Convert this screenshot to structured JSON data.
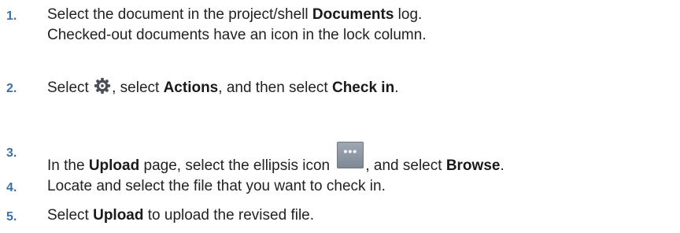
{
  "steps": [
    {
      "number": "1.",
      "line1": {
        "pre": "Select the document in the project/shell ",
        "bold": "Documents",
        "post": " log."
      },
      "line2": "Checked-out documents have an icon in the lock column."
    },
    {
      "number": "2.",
      "pre": "Select ",
      "icon": "gear-icon",
      "mid1": ", select ",
      "bold1": "Actions",
      "mid2": ", and then select ",
      "bold2": "Check in",
      "post": "."
    },
    {
      "number": "3.",
      "pre": "In the ",
      "bold1": "Upload",
      "mid1": " page, select the ellipsis icon ",
      "icon": "ellipsis-icon",
      "mid2": ", and select ",
      "bold2": "Browse",
      "post": "."
    },
    {
      "number": "4.",
      "text": "Locate and select the file that you want to check in."
    },
    {
      "number": "5.",
      "pre": "Select ",
      "bold": "Upload",
      "post": " to upload the revised file."
    }
  ]
}
